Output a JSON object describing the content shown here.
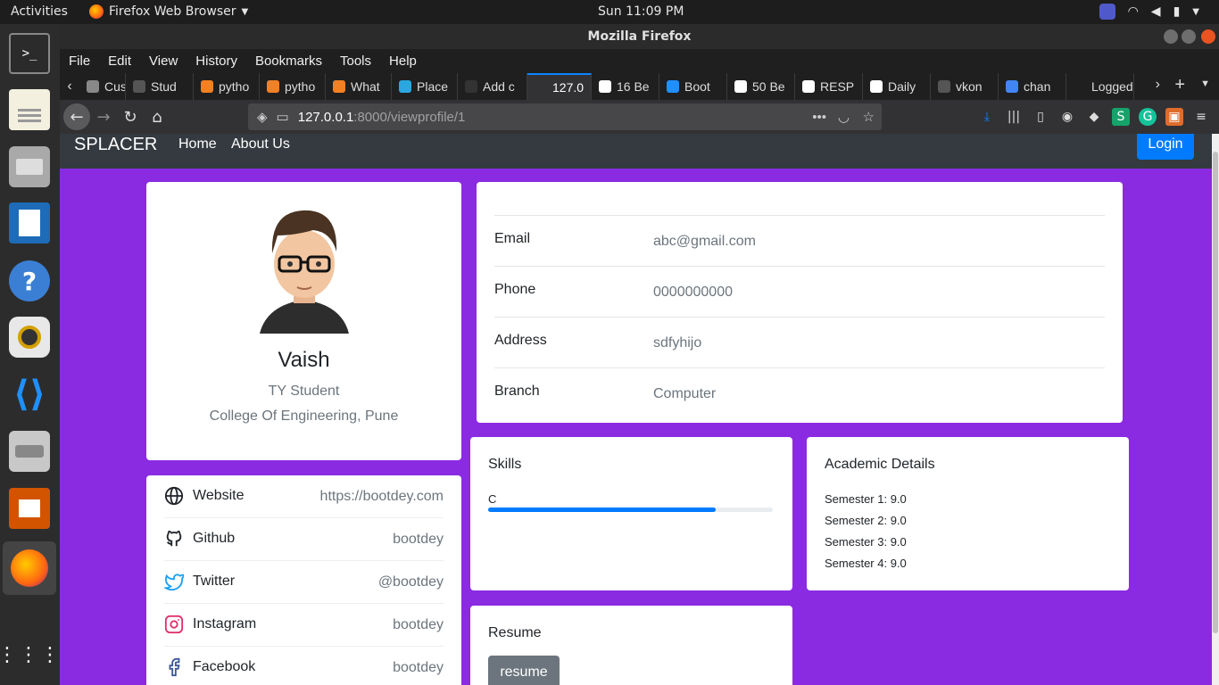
{
  "topbar": {
    "activities": "Activities",
    "app_name": "Firefox Web Browser",
    "clock": "Sun 11:09 PM"
  },
  "window": {
    "title": "Mozilla Firefox"
  },
  "menu": [
    "File",
    "Edit",
    "View",
    "History",
    "Bookmarks",
    "Tools",
    "Help"
  ],
  "tabs": [
    {
      "label": "Custo",
      "icon_color": "#888888"
    },
    {
      "label": "Stud",
      "icon_color": "#555555"
    },
    {
      "label": "pytho",
      "icon_color": "#f48024"
    },
    {
      "label": "pytho",
      "icon_color": "#f48024"
    },
    {
      "label": "What",
      "icon_color": "#f48024"
    },
    {
      "label": "Place",
      "icon_color": "#2aa7e0"
    },
    {
      "label": "Add c",
      "icon_color": "#333333"
    },
    {
      "label": "127.0",
      "icon_color": "#323234",
      "active": true
    },
    {
      "label": "16 Be",
      "icon_color": "#ffffff"
    },
    {
      "label": "Boot",
      "icon_color": "#1e90ff"
    },
    {
      "label": "50 Be",
      "icon_color": "#ffffff"
    },
    {
      "label": "RESP",
      "icon_color": "#ffffff"
    },
    {
      "label": "Daily",
      "icon_color": "#ffffff"
    },
    {
      "label": "vkon",
      "icon_color": "#555555"
    },
    {
      "label": "chan",
      "icon_color": "#4285f4"
    },
    {
      "label": "Logged",
      "icon_color": "#1f1f1f"
    }
  ],
  "url": {
    "host": "127.0.0.1",
    "rest": ":8000/viewprofile/1"
  },
  "site": {
    "brand": "SPLACER",
    "nav": [
      "Home",
      "About Us"
    ],
    "login": "Login"
  },
  "profile": {
    "name": "Vaish",
    "role": "TY Student",
    "college": "College Of Engineering, Pune"
  },
  "details": [
    {
      "label": "Email",
      "value": "abc@gmail.com"
    },
    {
      "label": "Phone",
      "value": "0000000000"
    },
    {
      "label": "Address",
      "value": "sdfyhijo"
    },
    {
      "label": "Branch",
      "value": "Computer"
    }
  ],
  "social": [
    {
      "name": "Website",
      "value": "https://bootdey.com",
      "icon": "globe-icon",
      "color": "#212529"
    },
    {
      "name": "Github",
      "value": "bootdey",
      "icon": "github-icon",
      "color": "#212529"
    },
    {
      "name": "Twitter",
      "value": "@bootdey",
      "icon": "twitter-icon",
      "color": "#1da1f2"
    },
    {
      "name": "Instagram",
      "value": "bootdey",
      "icon": "instagram-icon",
      "color": "#e1306c"
    },
    {
      "name": "Facebook",
      "value": "bootdey",
      "icon": "facebook-icon",
      "color": "#3b5998"
    }
  ],
  "skills": {
    "title": "Skills",
    "items": [
      {
        "name": "C",
        "progress": 0.8
      }
    ]
  },
  "academic": {
    "title": "Academic Details",
    "semesters": [
      "Semester 1: 9.0",
      "Semester 2: 9.0",
      "Semester 3: 9.0",
      "Semester 4: 9.0"
    ]
  },
  "resume": {
    "title": "Resume",
    "button": "resume"
  },
  "colors": {
    "page_bg": "#8a2be2",
    "navbar": "#343a40",
    "primary": "#007bff",
    "secondary": "#6c757d"
  }
}
